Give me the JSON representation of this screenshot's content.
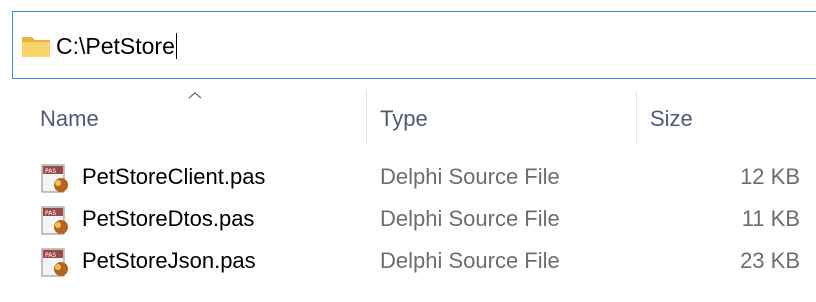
{
  "address_bar": {
    "path": "C:\\PetStore",
    "icon": "folder-icon"
  },
  "columns": {
    "name": "Name",
    "type": "Type",
    "size": "Size",
    "sort_indicator": "chevron-up-icon"
  },
  "files": [
    {
      "name": "PetStoreClient.pas",
      "type": "Delphi Source File",
      "size": "12 KB",
      "icon": "pas-file-icon"
    },
    {
      "name": "PetStoreDtos.pas",
      "type": "Delphi Source File",
      "size": "11 KB",
      "icon": "pas-file-icon"
    },
    {
      "name": "PetStoreJson.pas",
      "type": "Delphi Source File",
      "size": "23 KB",
      "icon": "pas-file-icon"
    }
  ],
  "colors": {
    "address_border": "#3d8ee0",
    "header_text": "#4f5b75",
    "secondary_text": "#6d6d6d",
    "folder_yellow": "#f5c84a"
  }
}
